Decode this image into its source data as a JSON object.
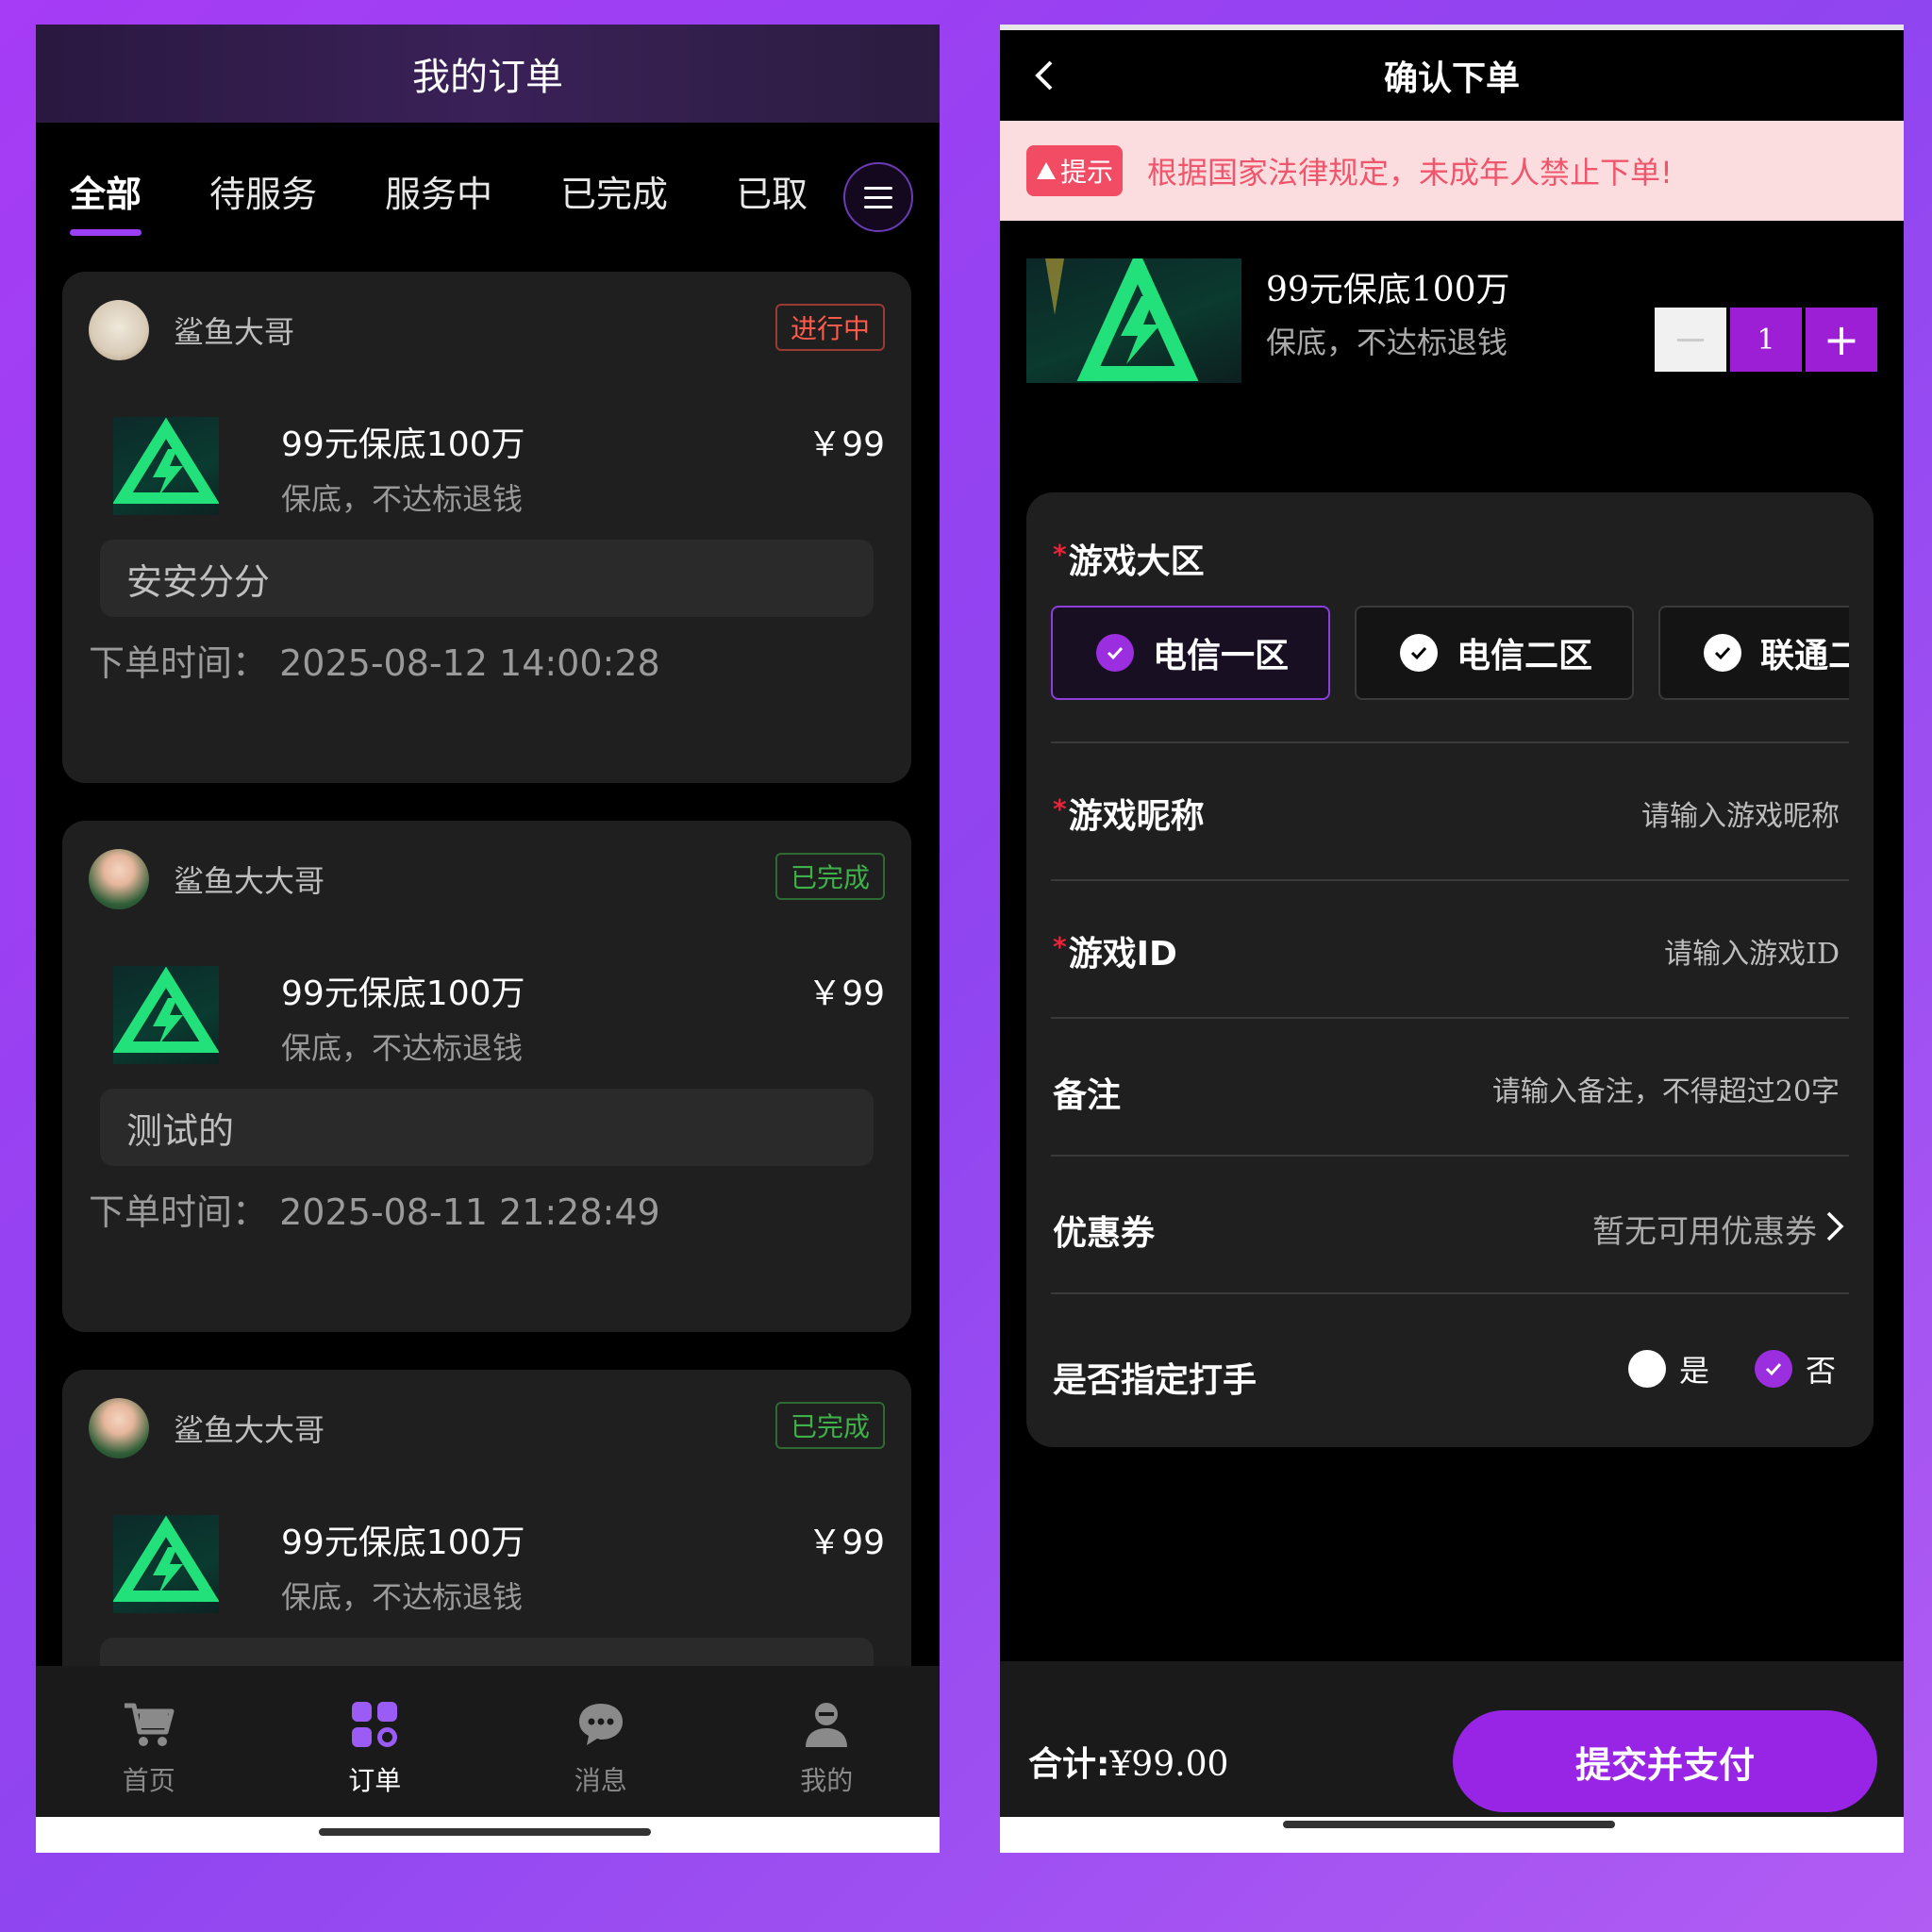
{
  "left": {
    "title": "我的订单",
    "tabs": [
      {
        "label": "全部",
        "active": true
      },
      {
        "label": "待服务",
        "active": false
      },
      {
        "label": "服务中",
        "active": false
      },
      {
        "label": "已完成",
        "active": false
      },
      {
        "label": "已取",
        "active": false
      }
    ],
    "menu_icon": "hamburger-menu-icon",
    "orders": [
      {
        "user": "鲨鱼大哥",
        "status": "进行中",
        "title": "99元保底100万",
        "price": "￥99",
        "subtitle": "保底，不达标退钱",
        "remark": "安安分分",
        "time_label": "下单时间：",
        "time": "2025-08-12 14:00:28"
      },
      {
        "user": "鲨鱼大大哥",
        "status": "已完成",
        "title": "99元保底100万",
        "price": "￥99",
        "subtitle": "保底，不达标退钱",
        "remark": "测试的",
        "time_label": "下单时间：",
        "time": "2025-08-11 21:28:49"
      },
      {
        "user": "鲨鱼大大哥",
        "status": "已完成",
        "title": "99元保底100万",
        "price": "￥99",
        "subtitle": "保底，不达标退钱",
        "remark": "",
        "time_label": "",
        "time": ""
      }
    ],
    "tabbar": [
      {
        "label": "首页",
        "icon": "cart-icon",
        "active": false
      },
      {
        "label": "订单",
        "icon": "grid-icon",
        "active": true
      },
      {
        "label": "消息",
        "icon": "chat-bubble-icon",
        "active": false
      },
      {
        "label": "我的",
        "icon": "user-icon",
        "active": false
      }
    ],
    "colors": {
      "accent": "#9b3ef5",
      "status_going": "#ff5a4a",
      "status_done": "#3fb14a"
    }
  },
  "right": {
    "title": "确认下单",
    "notice": {
      "tag": "提示",
      "text": "根据国家法律规定，未成年人禁止下单!"
    },
    "product": {
      "title": "99元保底100万",
      "subtitle": "保底，不达标退钱",
      "quantity": "1",
      "minus": "−",
      "plus": "+"
    },
    "form": {
      "zone_label": "游戏大区",
      "zones": [
        {
          "label": "电信一区",
          "selected": true
        },
        {
          "label": "电信二区",
          "selected": false
        },
        {
          "label": "联通二区",
          "selected": false
        }
      ],
      "nickname_label": "游戏昵称",
      "nickname_placeholder": "请输入游戏昵称",
      "gameid_label": "游戏ID",
      "gameid_placeholder": "请输入游戏ID",
      "remark_label": "备注",
      "remark_placeholder": "请输入备注，不得超过20字",
      "coupon_label": "优惠券",
      "coupon_value": "暂无可用优惠券",
      "assign_label": "是否指定打手",
      "assign_yes": "是",
      "assign_no": "否",
      "assign_selected": "否"
    },
    "footer": {
      "total_label": "合计:",
      "total_value": "¥99.00",
      "submit": "提交并支付"
    },
    "colors": {
      "accent": "#9c1fd6",
      "notice_bg": "#fbdde0",
      "notice_text": "#f0566b"
    }
  }
}
